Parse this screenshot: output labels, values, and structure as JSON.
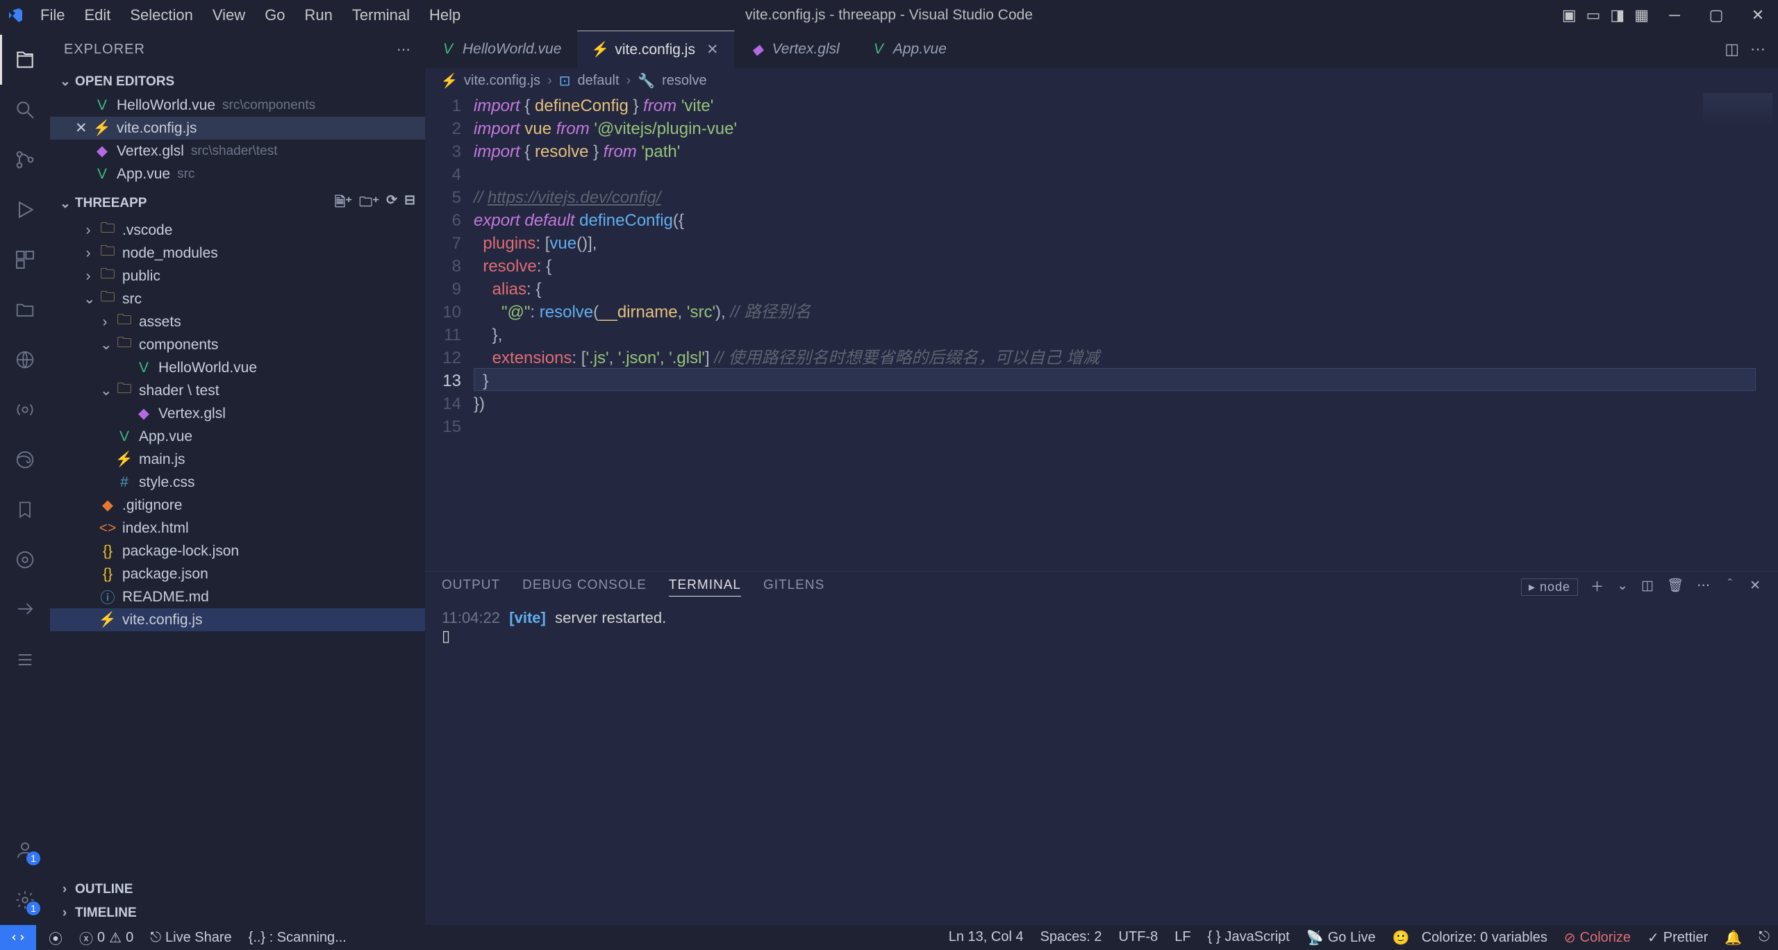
{
  "window": {
    "title": "vite.config.js - threeapp - Visual Studio Code"
  },
  "menu": [
    "File",
    "Edit",
    "Selection",
    "View",
    "Go",
    "Run",
    "Terminal",
    "Help"
  ],
  "sidebar": {
    "title": "EXPLORER",
    "openEditorsLabel": "OPEN EDITORS",
    "openEditors": [
      {
        "name": "HelloWorld.vue",
        "meta": "src\\components",
        "icon": "vue"
      },
      {
        "name": "vite.config.js",
        "meta": "",
        "icon": "js",
        "active": true
      },
      {
        "name": "Vertex.glsl",
        "meta": "src\\shader\\test",
        "icon": "glsl"
      },
      {
        "name": "App.vue",
        "meta": "src",
        "icon": "vue"
      }
    ],
    "projectLabel": "THREEAPP",
    "tree": [
      {
        "name": ".vscode",
        "type": "folder",
        "indent": 1,
        "open": false
      },
      {
        "name": "node_modules",
        "type": "folder",
        "indent": 1,
        "open": false
      },
      {
        "name": "public",
        "type": "folder",
        "indent": 1,
        "open": false
      },
      {
        "name": "src",
        "type": "folder",
        "indent": 1,
        "open": true
      },
      {
        "name": "assets",
        "type": "folder",
        "indent": 2,
        "open": false
      },
      {
        "name": "components",
        "type": "folder",
        "indent": 2,
        "open": true
      },
      {
        "name": "HelloWorld.vue",
        "type": "vue",
        "indent": 3
      },
      {
        "name": "shader \\ test",
        "type": "folder",
        "indent": 2,
        "open": true
      },
      {
        "name": "Vertex.glsl",
        "type": "glsl",
        "indent": 3
      },
      {
        "name": "App.vue",
        "type": "vue",
        "indent": 2
      },
      {
        "name": "main.js",
        "type": "js",
        "indent": 2
      },
      {
        "name": "style.css",
        "type": "css",
        "indent": 2
      },
      {
        "name": ".gitignore",
        "type": "git",
        "indent": 1
      },
      {
        "name": "index.html",
        "type": "html",
        "indent": 1
      },
      {
        "name": "package-lock.json",
        "type": "json",
        "indent": 1
      },
      {
        "name": "package.json",
        "type": "json",
        "indent": 1
      },
      {
        "name": "README.md",
        "type": "md",
        "indent": 1
      },
      {
        "name": "vite.config.js",
        "type": "js",
        "indent": 1,
        "selected": true
      }
    ],
    "outlineLabel": "OUTLINE",
    "timelineLabel": "TIMELINE"
  },
  "tabs": [
    {
      "label": "HelloWorld.vue",
      "icon": "vue"
    },
    {
      "label": "vite.config.js",
      "icon": "js",
      "active": true
    },
    {
      "label": "Vertex.glsl",
      "icon": "glsl"
    },
    {
      "label": "App.vue",
      "icon": "vue"
    }
  ],
  "breadcrumb": {
    "file": "vite.config.js",
    "symbol1": "default",
    "symbol2": "resolve"
  },
  "code": {
    "lines": [
      {
        "n": 1,
        "html": "<span class='kw'>import</span> <span class='pun'>{</span> <span class='var-y'>defineConfig</span> <span class='pun'>}</span> <span class='kw'>from</span> <span class='str'>'vite'</span>"
      },
      {
        "n": 2,
        "html": "<span class='kw'>import</span> <span class='var-y'>vue</span> <span class='kw'>from</span> <span class='str'>'@vitejs/plugin-vue'</span>"
      },
      {
        "n": 3,
        "html": "<span class='kw'>import</span> <span class='pun'>{</span> <span class='var-y'>resolve</span> <span class='pun'>}</span> <span class='kw'>from</span> <span class='str'>'path'</span>"
      },
      {
        "n": 4,
        "html": ""
      },
      {
        "n": 5,
        "html": "<span class='cmt'>// </span><span class='link'>https://vitejs.dev/config/</span>"
      },
      {
        "n": 6,
        "html": "<span class='kw'>export</span> <span class='kw'>default</span> <span class='fn'>defineConfig</span><span class='pun'>({</span>"
      },
      {
        "n": 7,
        "html": "  <span class='prop'>plugins</span><span class='pun'>:</span> <span class='pun'>[</span><span class='fn'>vue</span><span class='pun'>()],</span>"
      },
      {
        "n": 8,
        "html": "  <span class='prop'>resolve</span><span class='pun'>:</span> <span class='pun'>{</span>"
      },
      {
        "n": 9,
        "html": "    <span class='prop'>alias</span><span class='pun'>:</span> <span class='pun'>{</span>"
      },
      {
        "n": 10,
        "html": "      <span class='str'>\"@\"</span><span class='pun'>:</span> <span class='fn'>resolve</span><span class='pun'>(</span><span class='var-y'>__dirname</span><span class='pun'>,</span> <span class='str'>'src'</span><span class='pun'>),</span> <span class='cmt'>// 路径别名</span>"
      },
      {
        "n": 11,
        "html": "    <span class='pun'>},</span>"
      },
      {
        "n": 12,
        "html": "    <span class='prop'>extensions</span><span class='pun'>:</span> <span class='pun'>[</span><span class='str'>'.js'</span><span class='pun'>,</span> <span class='str'>'.json'</span><span class='pun'>,</span> <span class='str'>'.glsl'</span><span class='pun'>]</span> <span class='cmt'>// 使用路径别名时想要省略的后缀名，可以自己 增减</span>"
      },
      {
        "n": 13,
        "html": "  <span class='pun'>}</span>",
        "active": true
      },
      {
        "n": 14,
        "html": "<span class='pun'>})</span>"
      },
      {
        "n": 15,
        "html": ""
      }
    ]
  },
  "panel": {
    "tabs": [
      "OUTPUT",
      "DEBUG CONSOLE",
      "TERMINAL",
      "GITLENS"
    ],
    "activeTab": "TERMINAL",
    "shell": "node",
    "term": {
      "time": "11:04:22",
      "tag": "[vite]",
      "msg": "server restarted."
    }
  },
  "status": {
    "errors": "0",
    "warnings": "0",
    "liveshare": "Live Share",
    "scanning": "{..} : Scanning...",
    "pos": "Ln 13, Col 4",
    "spaces": "Spaces: 2",
    "enc": "UTF-8",
    "eol": "LF",
    "lang": "JavaScript",
    "golive": "Go Live",
    "colorizeVars": "Colorize: 0 variables",
    "colorize": "Colorize",
    "prettier": "Prettier"
  }
}
